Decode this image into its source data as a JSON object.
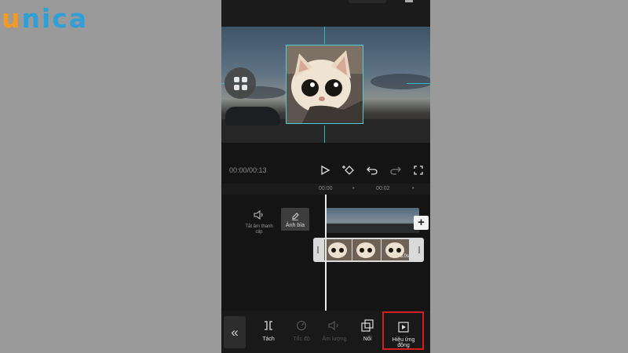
{
  "brand": {
    "logo_first": "u",
    "logo_rest": "nica",
    "color_primary": "#2f9fd8",
    "color_accent": "#f29a25"
  },
  "preview": {
    "grid_icon": "grid-icon"
  },
  "playback": {
    "time": "00:00/00:13",
    "icons": [
      "play-icon",
      "keyframe-icon",
      "undo-icon",
      "redo-icon",
      "fullscreen-icon"
    ]
  },
  "ruler": {
    "t0": "00:00",
    "t1": "00:02"
  },
  "tracks": {
    "mute_label": "Tắt âm thanh clip",
    "cover_label": "Ảnh bìa",
    "clip_duration": "3.0s",
    "add_label": "+"
  },
  "toolbar": {
    "back_icon": "double-chevron-left-icon",
    "items": [
      {
        "label": "Tách",
        "icon": "split-icon",
        "enabled": true
      },
      {
        "label": "Tốc độ",
        "icon": "speed-icon",
        "enabled": false
      },
      {
        "label": "Âm lượng",
        "icon": "volume-icon",
        "enabled": false
      },
      {
        "label": "Nối",
        "icon": "overlay-icon",
        "enabled": true
      },
      {
        "label": "Hiệu ứng động",
        "icon": "animation-icon",
        "enabled": true,
        "highlighted": true
      }
    ],
    "highlight_color": "#d21f1f"
  }
}
